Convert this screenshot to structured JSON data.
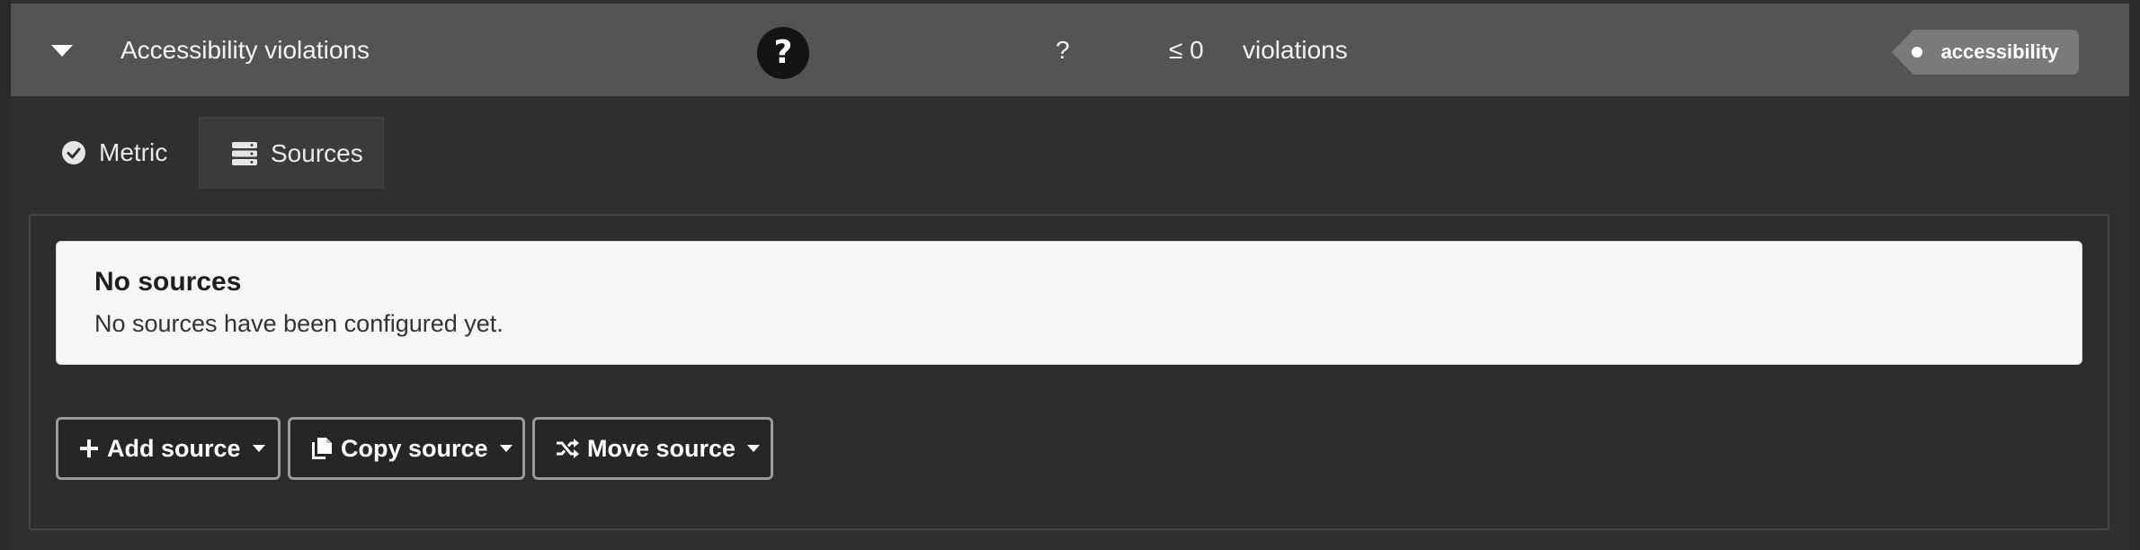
{
  "metric_row": {
    "title": "Accessibility violations",
    "help_icon": "question-circle-icon",
    "value": "?",
    "target": "≤ 0",
    "unit": "violations",
    "tag": "accessibility"
  },
  "tabs": [
    {
      "label": "Metric",
      "icon": "check-circle-icon"
    },
    {
      "label": "Sources",
      "icon": "server-icon"
    }
  ],
  "active_tab": "Sources",
  "sources_panel": {
    "message": {
      "header": "No sources",
      "body": "No sources have been configured yet."
    },
    "buttons": {
      "add": {
        "label": "Add source",
        "icon": "plus-icon"
      },
      "copy": {
        "label": "Copy source",
        "icon": "copy-icon"
      },
      "move": {
        "label": "Move source",
        "icon": "shuffle-icon"
      }
    }
  },
  "colors": {
    "header_bg": "#545454",
    "page_bg": "#2f2f2f",
    "message_bg": "#f7f7f7",
    "tag_bg": "#7a7a7a"
  }
}
